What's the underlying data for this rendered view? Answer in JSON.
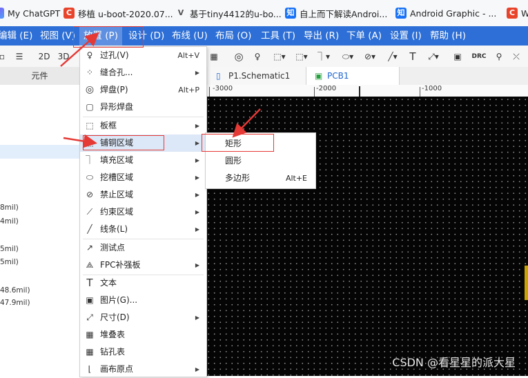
{
  "bookmarks": [
    {
      "label": "My ChatGPT",
      "icon": "chatgpt-icon"
    },
    {
      "label": "移植 u-boot-2020.07...",
      "icon": "csdn-icon"
    },
    {
      "label": "基于tiny4412的u-bo...",
      "icon": "v-icon"
    },
    {
      "label": "自上而下解读Androi...",
      "icon": "zhihu-icon"
    },
    {
      "label": "Android Graphic - ...",
      "icon": "zhihu-icon"
    },
    {
      "label": "W",
      "icon": "csdn-icon"
    }
  ],
  "menubar": {
    "items": [
      "编辑 (E)",
      "视图 (V)",
      "放置 (P)",
      "设计 (D)",
      "布线 (U)",
      "布局 (O)",
      "工具 (T)",
      "导出 (R)",
      "下单 (A)",
      "设置 (I)",
      "帮助 (H)"
    ],
    "active": "放置 (P)"
  },
  "toolbar": {
    "btn_2d": "2D",
    "btn_3d": "3D",
    "btn_drc": "DRC"
  },
  "tabs": {
    "left": "元件",
    "schematic": "P1.Schematic1",
    "pcb": "PCB1"
  },
  "ruler": {
    "labels": [
      "-3000",
      "-2000",
      "-1000"
    ]
  },
  "leftpanel": {
    "values": [
      "8mil)",
      "4mil)",
      "5mil)",
      "5mil)",
      "48.6mil)",
      "47.9mil)"
    ]
  },
  "menu": {
    "items": [
      {
        "label": "过孔(V)",
        "shortcut": "Alt+V",
        "icon": "via-icon"
      },
      {
        "label": "缝合孔...",
        "submenu": true,
        "icon": "stitch-via-icon"
      },
      {
        "label": "焊盘(P)",
        "shortcut": "Alt+P",
        "icon": "pad-icon"
      },
      {
        "label": "异形焊盘",
        "icon": "custom-pad-icon"
      },
      {
        "label": "板框",
        "submenu": true,
        "icon": "board-outline-icon"
      },
      {
        "label": "铺铜区域",
        "submenu": true,
        "icon": "copper-area-icon",
        "highlighted": true
      },
      {
        "label": "填充区域",
        "submenu": true,
        "icon": "fill-area-icon"
      },
      {
        "label": "挖槽区域",
        "submenu": true,
        "icon": "slot-area-icon"
      },
      {
        "label": "禁止区域",
        "submenu": true,
        "icon": "keepout-area-icon"
      },
      {
        "label": "约束区域",
        "submenu": true,
        "icon": "constraint-area-icon"
      },
      {
        "label": "线条(L)",
        "submenu": true,
        "icon": "line-icon"
      },
      {
        "label": "测试点",
        "icon": "test-point-icon"
      },
      {
        "label": "FPC补强板",
        "submenu": true,
        "icon": "fpc-stiffener-icon"
      },
      {
        "label": "文本",
        "icon": "text-icon"
      },
      {
        "label": "图片(G)...",
        "icon": "image-icon"
      },
      {
        "label": "尺寸(D)",
        "submenu": true,
        "icon": "dimension-icon"
      },
      {
        "label": "堆叠表",
        "icon": "stackup-table-icon"
      },
      {
        "label": "钻孔表",
        "icon": "drill-table-icon"
      },
      {
        "label": "画布原点",
        "submenu": true,
        "icon": "canvas-origin-icon"
      }
    ]
  },
  "submenu": {
    "items": [
      {
        "label": "矩形"
      },
      {
        "label": "圆形"
      },
      {
        "label": "多边形",
        "shortcut": "Alt+E"
      }
    ]
  },
  "watermark": "CSDN @看星星的派大星"
}
